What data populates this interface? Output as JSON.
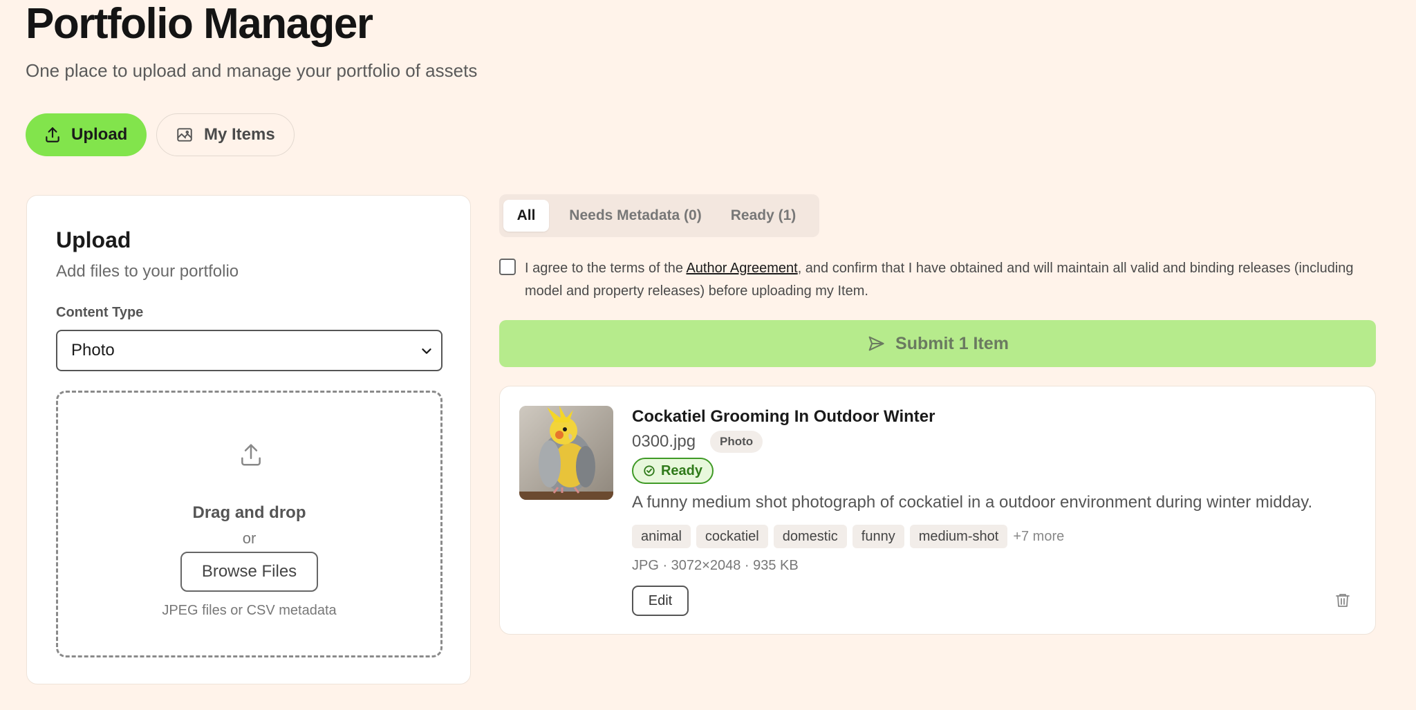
{
  "header": {
    "title": "Portfolio Manager",
    "subtitle": "One place to upload and manage your portfolio of assets"
  },
  "nav": {
    "upload_label": "Upload",
    "my_items_label": "My Items"
  },
  "upload_panel": {
    "title": "Upload",
    "subtitle": "Add files to your portfolio",
    "content_type_label": "Content Type",
    "content_type_value": "Photo",
    "drag_drop_text": "Drag and drop",
    "or_text": "or",
    "browse_label": "Browse Files",
    "hint": "JPEG files or CSV metadata"
  },
  "filters": {
    "all": "All",
    "needs_metadata": "Needs Metadata (0)",
    "ready": "Ready (1)"
  },
  "agreement": {
    "prefix": "I agree to the terms of the ",
    "link": "Author Agreement",
    "suffix": ", and confirm that I have obtained and will maintain all valid and binding releases (including model and property releases) before uploading my Item."
  },
  "submit": {
    "label": "Submit 1 Item"
  },
  "item": {
    "title": "Cockatiel Grooming In Outdoor Winter",
    "filename": "0300.jpg",
    "type": "Photo",
    "status": "Ready",
    "description": "A funny medium shot photograph of cockatiel in a outdoor environment during winter midday.",
    "tags": [
      "animal",
      "cockatiel",
      "domestic",
      "funny",
      "medium-shot"
    ],
    "more_tags": "+7 more",
    "meta": "JPG · 3072×2048 · 935 KB",
    "edit_label": "Edit"
  },
  "colors": {
    "background": "#fff3ea",
    "accent": "#82e44c",
    "submit_disabled": "#b6eb8c",
    "ready_green": "#3f9a26"
  },
  "icons": {
    "upload": "upload-icon",
    "my_items": "image-icon",
    "dropzone": "upload-icon",
    "submit": "send-icon",
    "status": "check-circle-icon",
    "delete": "trash-icon",
    "select": "chevron-down-icon"
  }
}
